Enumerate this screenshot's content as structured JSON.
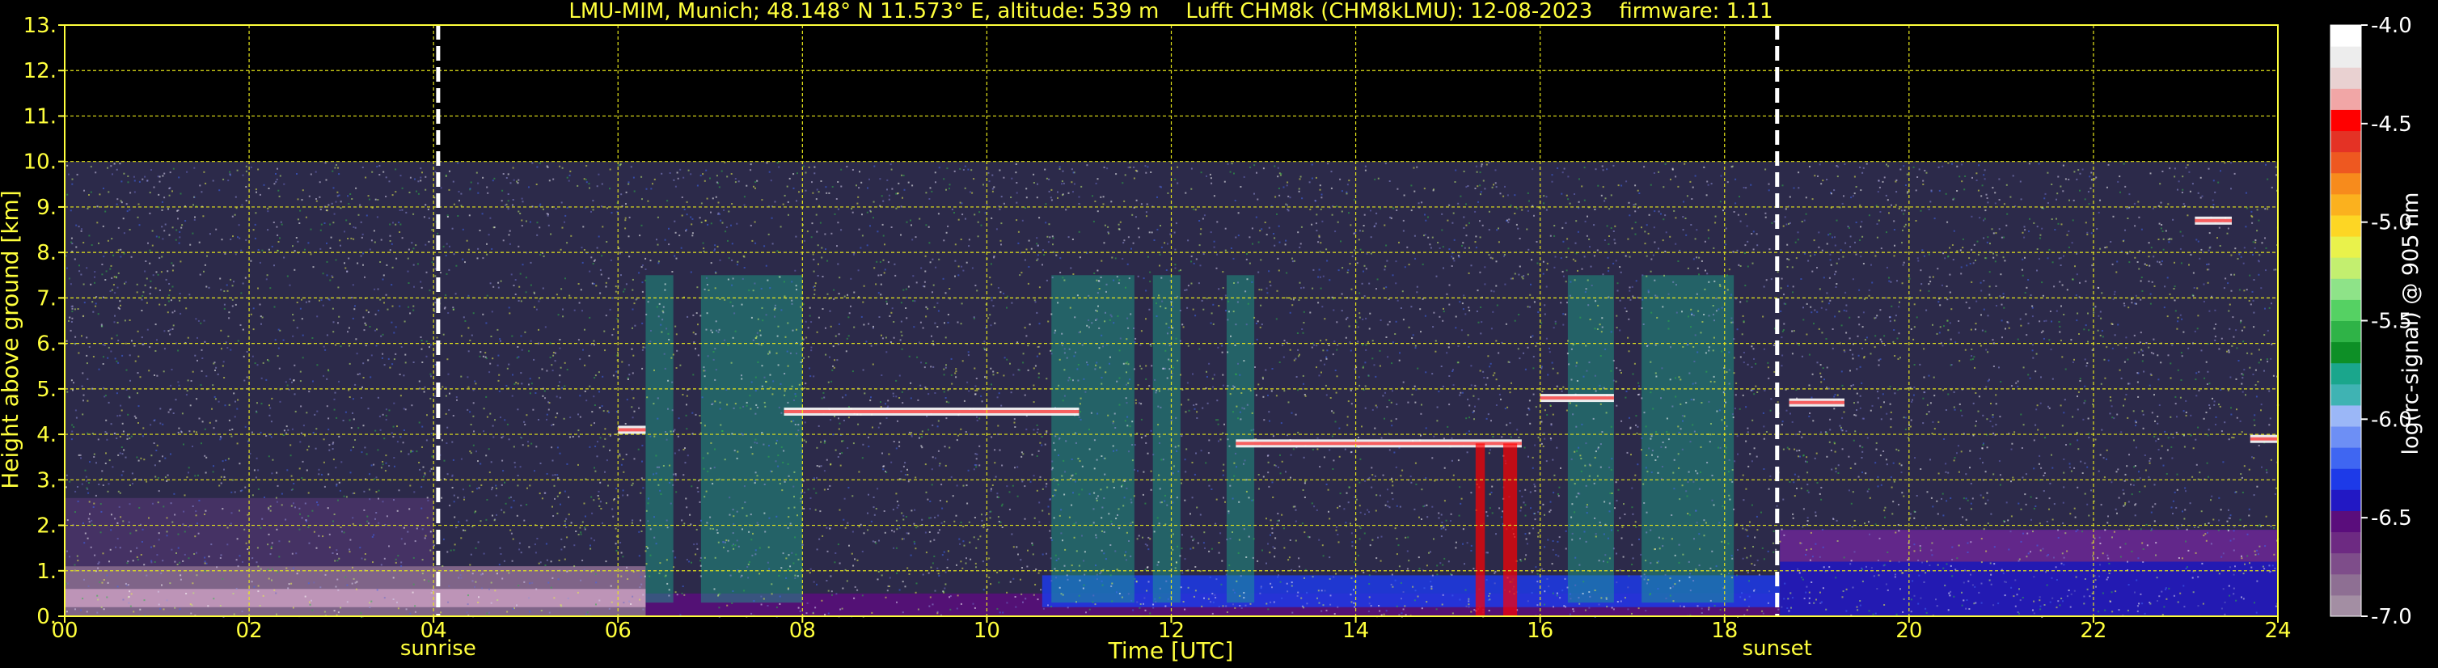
{
  "chart_data": {
    "type": "heatmap",
    "title": "LMU-MIM, Munich; 48.148° N 11.573° E, altitude: 539 m    Lufft CHM8k (CHM8kLMU): 12-08-2023    firmware: 1.11",
    "xlabel": "Time [UTC]",
    "ylabel": "Height above ground [km]",
    "xlim": [
      0,
      24
    ],
    "ylim": [
      0,
      13
    ],
    "x_ticks": [
      "00",
      "02",
      "04",
      "06",
      "08",
      "10",
      "12",
      "14",
      "16",
      "18",
      "20",
      "22",
      "24"
    ],
    "y_ticks": [
      "0.",
      "1.",
      "2.",
      "3.",
      "4.",
      "5.",
      "6.",
      "7.",
      "8.",
      "9.",
      "10.",
      "11.",
      "12.",
      "13."
    ],
    "grid": true,
    "data_top_km": 10,
    "markers": [
      {
        "label": "sunrise",
        "time_utc": 4.05
      },
      {
        "label": "sunset",
        "time_utc": 18.57
      }
    ],
    "colorbar": {
      "label": "log(rc-signal) @ 905 nm",
      "range": [
        -7.0,
        -4.0
      ],
      "ticks": [
        "-4.0",
        "-4.5",
        "-5.0",
        "-5.5",
        "-6.0",
        "-6.5",
        "-7.0"
      ],
      "colors": [
        "#a38ea3",
        "#8e6f93",
        "#7e4d8a",
        "#6d2a82",
        "#5a0d7c",
        "#2218c4",
        "#1d3ae8",
        "#3f66f2",
        "#6d8ff5",
        "#9bb7f7",
        "#3fb3b3",
        "#1aa68c",
        "#0d8f26",
        "#2fb347",
        "#55d163",
        "#8ee388",
        "#c3ef6f",
        "#e9f24b",
        "#fdd624",
        "#fbb11e",
        "#f78b1c",
        "#ee5820",
        "#e43225",
        "#ff0000",
        "#f1a6a6",
        "#e9d1d1",
        "#ededed",
        "#ffffff"
      ]
    },
    "cloud_layers_km": [
      {
        "from_utc": 6.0,
        "to_utc": 6.3,
        "height_km": 4.1
      },
      {
        "from_utc": 7.8,
        "to_utc": 11.0,
        "height_km": 4.5
      },
      {
        "from_utc": 12.7,
        "to_utc": 15.8,
        "height_km": 3.8
      },
      {
        "from_utc": 16.0,
        "to_utc": 16.8,
        "height_km": 4.8
      },
      {
        "from_utc": 18.7,
        "to_utc": 19.3,
        "height_km": 4.7
      },
      {
        "from_utc": 23.7,
        "to_utc": 24.0,
        "height_km": 3.9
      },
      {
        "from_utc": 23.1,
        "to_utc": 23.5,
        "height_km": 8.7
      }
    ]
  }
}
